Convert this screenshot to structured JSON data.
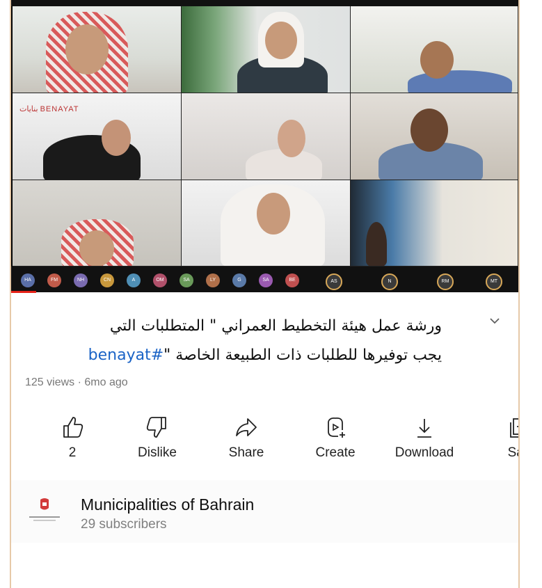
{
  "video": {
    "participants": [
      "HA",
      "FM",
      "NH",
      "CN",
      "A",
      "OM",
      "SA",
      "LY",
      "G",
      "SA",
      "BE",
      "AS",
      "N",
      "RM",
      "MT"
    ],
    "tile_logo": "بنايات BENAYAT",
    "progress": 0.05
  },
  "title": {
    "line1": "ورشة عمل هيئة التخطيط العمراني \" المتطلبات التي",
    "line2_text": "يجب توفيرها للطلبات ذات الطبيعة الخاصة \"",
    "hashtag": "#benayat"
  },
  "meta": "125 views · 6mo ago",
  "actions": [
    {
      "icon": "thumbs-up-icon",
      "label": "2"
    },
    {
      "icon": "thumbs-down-icon",
      "label": "Dislike"
    },
    {
      "icon": "share-icon",
      "label": "Share"
    },
    {
      "icon": "create-icon",
      "label": "Create"
    },
    {
      "icon": "download-icon",
      "label": "Download"
    },
    {
      "icon": "save-icon",
      "label": "Sav"
    }
  ],
  "channel": {
    "name": "Municipalities of Bahrain",
    "subscribers": "29 subscribers"
  },
  "colors": {
    "hashtag": "#1a63c6",
    "progress": "#e62117"
  }
}
